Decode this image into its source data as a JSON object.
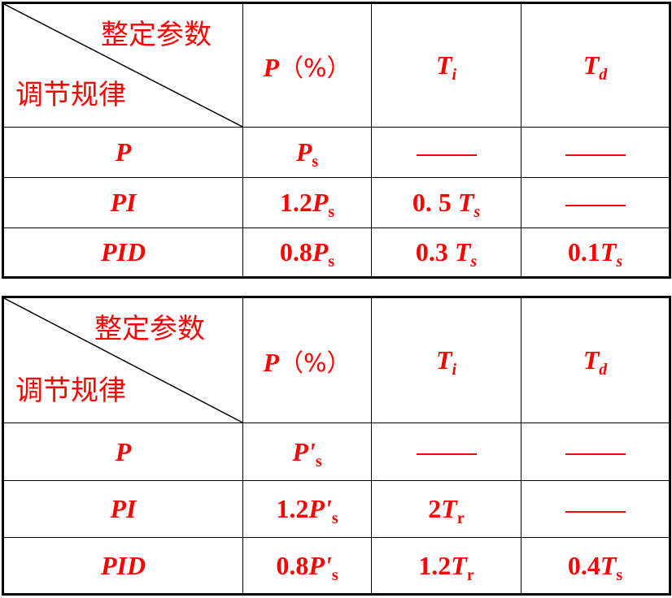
{
  "table1": {
    "corner_top": "整定参数",
    "corner_bottom": "调节规律",
    "header": {
      "p_symbol": "P",
      "p_unit": "（%）",
      "ti_main": "T",
      "ti_sub": "i",
      "td_main": "T",
      "td_sub": "d"
    },
    "rows": [
      {
        "law": "P",
        "p_prefix": "",
        "p_main": "P",
        "p_sub": "s",
        "ti_prefix": "",
        "ti_main": "",
        "ti_sub": "",
        "td_prefix": "",
        "td_main": "",
        "td_sub": "",
        "ti_dash": true,
        "td_dash": true
      },
      {
        "law": "PI",
        "p_prefix": "1.2",
        "p_main": "P",
        "p_sub": "s",
        "ti_prefix": "0. 5 ",
        "ti_main": "T",
        "ti_sub": "s",
        "td_prefix": "",
        "td_main": "",
        "td_sub": "",
        "td_dash": true
      },
      {
        "law": "PID",
        "p_prefix": "0.8",
        "p_main": "P",
        "p_sub": "s",
        "ti_prefix": "0.3 ",
        "ti_main": "T",
        "ti_sub": "s",
        "td_prefix": "0.1",
        "td_main": "T",
        "td_sub": "s"
      }
    ]
  },
  "table2": {
    "corner_top": "整定参数",
    "corner_bottom": "调节规律",
    "header": {
      "p_symbol": "P",
      "p_unit": "（%）",
      "ti_main": "T",
      "ti_sub": "i",
      "td_main": "T",
      "td_sub": "d"
    },
    "rows": [
      {
        "law": "P",
        "p_prefix": "",
        "p_main": "P'",
        "p_sub": "s",
        "ti_prefix": "",
        "ti_main": "",
        "ti_sub": "",
        "td_prefix": "",
        "td_main": "",
        "td_sub": "",
        "ti_dash": true,
        "td_dash": true
      },
      {
        "law": "PI",
        "p_prefix": "1.2",
        "p_main": "P'",
        "p_sub": "s",
        "ti_prefix": "2",
        "ti_main": "T",
        "ti_sub": "r",
        "td_prefix": "",
        "td_main": "",
        "td_sub": "",
        "td_dash": true
      },
      {
        "law": "PID",
        "p_prefix": "0.8",
        "p_main": "P'",
        "p_sub": "s",
        "ti_prefix": "1.2",
        "ti_main": "T",
        "ti_sub": "r",
        "td_prefix": "0.4",
        "td_main": "T",
        "td_sub": "s"
      }
    ]
  },
  "colors": {
    "text": "#ff0000",
    "border": "#000000"
  }
}
